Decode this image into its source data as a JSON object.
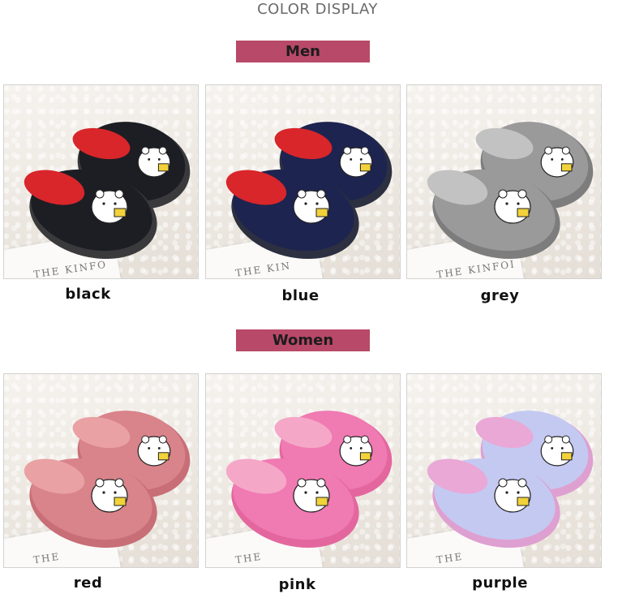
{
  "heading": "COLOR DISPLAY",
  "sections": {
    "men": {
      "label": "Men",
      "items": [
        {
          "name": "black",
          "upper": "#1c1e24",
          "lining": "#d8262a",
          "sole": "#3a3a3c",
          "book_text": "THE\nKINFO"
        },
        {
          "name": "blue",
          "upper": "#1d2450",
          "lining": "#d8262a",
          "sole": "#2c3040",
          "book_text": "THE\nKIN"
        },
        {
          "name": "grey",
          "upper": "#9a9a9a",
          "lining": "#c2c2c2",
          "sole": "#7d7d7d",
          "book_text": "THE\nKINFOI"
        }
      ]
    },
    "women": {
      "label": "Women",
      "items": [
        {
          "name": "red",
          "upper": "#d9838a",
          "lining": "#e9a1a4",
          "sole": "#c86e76",
          "book_text": "THE"
        },
        {
          "name": "pink",
          "upper": "#f07ab2",
          "lining": "#f5a7c8",
          "sole": "#e3679e",
          "book_text": "THE"
        },
        {
          "name": "purple",
          "upper": "#c4c9f2",
          "lining": "#e9a8d6",
          "sole": "#dea0d0",
          "book_text": "THE"
        }
      ]
    }
  },
  "banner_color": "#b84968"
}
